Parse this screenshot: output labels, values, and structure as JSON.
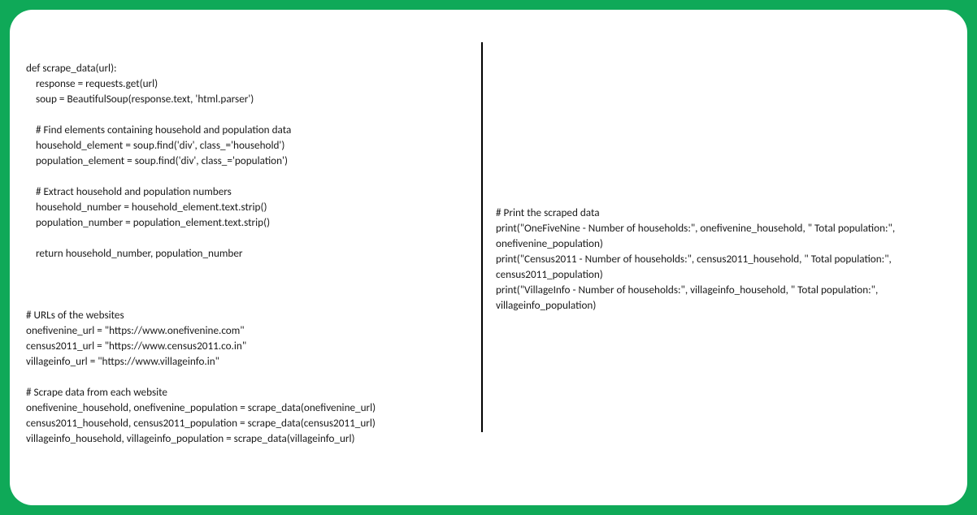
{
  "left_code": "def scrape_data(url):\n    response = requests.get(url)\n    soup = BeautifulSoup(response.text, 'html.parser')\n\n    # Find elements containing household and population data\n    household_element = soup.find('div', class_='household')\n    population_element = soup.find('div', class_='population')\n\n    # Extract household and population numbers\n    household_number = household_element.text.strip()\n    population_number = population_element.text.strip()\n\n    return household_number, population_number\n\n\n\n# URLs of the websites\nonefivenine_url = \"https://www.onefivenine.com\"\ncensus2011_url = \"https://www.census2011.co.in\"\nvillageinfo_url = \"https://www.villageinfo.in\"\n\n# Scrape data from each website\nonefivenine_household, onefivenine_population = scrape_data(onefivenine_url)\ncensus2011_household, census2011_population = scrape_data(census2011_url)\nvillageinfo_household, villageinfo_population = scrape_data(villageinfo_url)",
  "right_code": "# Print the scraped data\nprint(\"OneFiveNine - Number of households:\", onefivenine_household, \" Total population:\", onefivenine_population)\nprint(\"Census2011 - Number of households:\", census2011_household, \" Total population:\", census2011_population)\nprint(\"VillageInfo - Number of households:\", villageinfo_household, \" Total population:\", villageinfo_population)"
}
